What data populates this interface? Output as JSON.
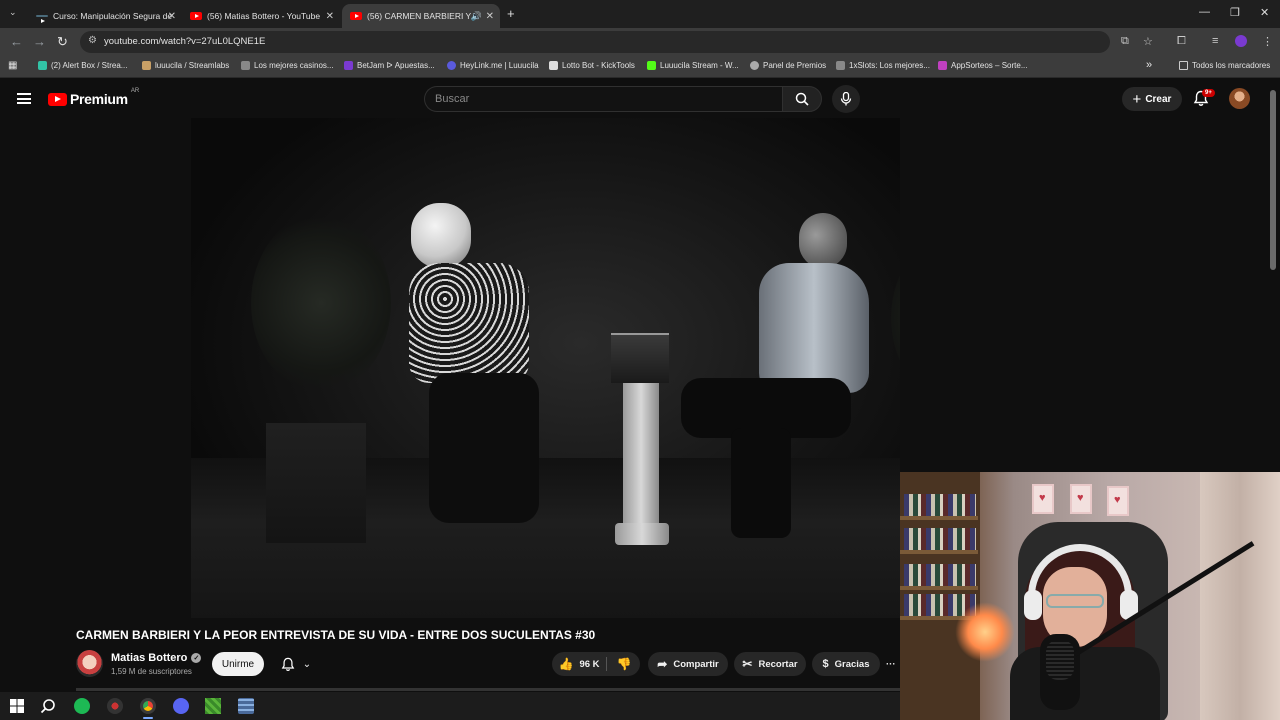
{
  "browser": {
    "tabs": [
      {
        "title": "Curso: Manipulación Segura de",
        "active": false,
        "close": "✕"
      },
      {
        "title": "(56) Matias Bottero - YouTube",
        "active": false,
        "close": "✕"
      },
      {
        "title": "(56) CARMEN BARBIERI Y L",
        "active": true,
        "close": "✕"
      }
    ],
    "new_tab": "+",
    "url": "youtube.com/watch?v=27uL0LQNE1E",
    "bookmarks": [
      {
        "label": "(2) Alert Box / Strea...",
        "color": "#32c3a6"
      },
      {
        "label": "luuucila / Streamlabs",
        "color": "#c9a066"
      },
      {
        "label": "Los mejores casinos...",
        "color": "#888888"
      },
      {
        "label": "BetJam ᐅ Apuestas...",
        "color": "#7a3ad0"
      },
      {
        "label": "HeyLink.me | Luuucila",
        "color": "#5a5adc"
      },
      {
        "label": "Lotto Bot - KickTools",
        "color": "#dddddd"
      },
      {
        "label": "Luuucila Stream - W...",
        "color": "#53fc18"
      },
      {
        "label": "Panel de Premios",
        "color": "#aaaaaa"
      },
      {
        "label": "1xSlots: Los mejores...",
        "color": "#888888"
      },
      {
        "label": "AppSorteos – Sorte...",
        "color": "#c040c0"
      }
    ],
    "bookmarks_more": "»",
    "all_bookmarks": "Todos los marcadores"
  },
  "youtube": {
    "logo_text": "Premium",
    "country_code": "AR",
    "search_placeholder": "Buscar",
    "create_label": "Crear",
    "notifications_badge": "9+",
    "video": {
      "title": "CARMEN BARBIERI Y LA PEOR ENTREVISTA DE SU VIDA - ENTRE DOS SUCULENTAS #30",
      "channel": "Matias Bottero",
      "subscribers": "1,59 M de suscriptores",
      "join_label": "Unirme",
      "likes": "96 K",
      "share_label": "Compartir",
      "clip_label": "Recortar",
      "thanks_label": "Gracias",
      "more": "···"
    }
  },
  "colors": {
    "brand_red": "#ff0000",
    "background": "#0f0f0f",
    "pill_bg": "#272727"
  }
}
